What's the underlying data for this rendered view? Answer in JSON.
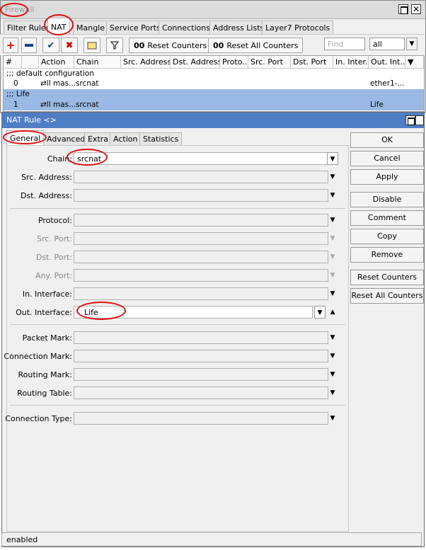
{
  "firewall": {
    "title": "Firewall",
    "tabs": [
      "Filter Rules",
      "NAT",
      "Mangle",
      "Service Ports",
      "Connections",
      "Address Lists",
      "Layer7 Protocols"
    ],
    "toolbar": {
      "reset_counters": "Reset Counters",
      "reset_all_counters": "Reset All Counters",
      "find_placeholder": "Find",
      "filter_value": "all"
    },
    "columns": [
      "#",
      "Action",
      "Chain",
      "Src. Address",
      "Dst. Address",
      "Proto...",
      "Src. Port",
      "Dst. Port",
      "In. Inter...",
      "Out. Int..."
    ],
    "rows": [
      {
        "comment": ";;; default configuration"
      },
      {
        "num": "0",
        "action": "⇄ll mas...",
        "chain": "srcnat",
        "out": "ether1-..."
      },
      {
        "comment": ";;; Life"
      },
      {
        "num": "1",
        "action": "⇄ll mas...",
        "chain": "srcnat",
        "out": "Life"
      }
    ]
  },
  "dialog": {
    "title": "NAT Rule <>",
    "tabs": [
      "General",
      "Advanced",
      "Extra",
      "Action",
      "Statistics"
    ],
    "fields": {
      "chain_label": "Chain:",
      "chain_value": "srcnat",
      "src_address": "Src. Address:",
      "dst_address": "Dst. Address:",
      "protocol": "Protocol:",
      "src_port": "Src. Port:",
      "dst_port": "Dst. Port:",
      "any_port": "Any. Port:",
      "in_interface": "In. Interface:",
      "out_interface_label": "Out. Interface:",
      "out_interface_value": "Life",
      "packet_mark": "Packet Mark:",
      "connection_mark": "Connection Mark:",
      "routing_mark": "Routing Mark:",
      "routing_table": "Routing Table:",
      "connection_type": "Connection Type:"
    },
    "buttons": [
      "OK",
      "Cancel",
      "Apply",
      "Disable",
      "Comment",
      "Copy",
      "Remove",
      "Reset Counters",
      "Reset All Counters"
    ],
    "status": "enabled"
  },
  "colors": {
    "selected_row": "#9ab9e4",
    "title_active": "#4f7ec4",
    "annotation": "#d11111"
  }
}
